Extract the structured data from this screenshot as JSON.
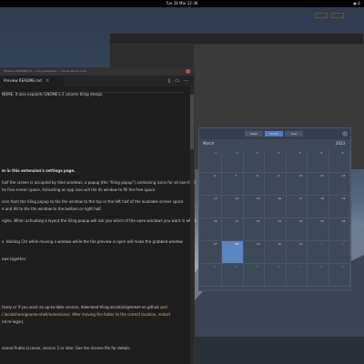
{
  "topbar": {
    "clock": "Tue 28 Mar  22:36",
    "tray": "◉ ⏻"
  },
  "term": {
    "title": "",
    "tab_colors": [
      "#2e8b57",
      "#b23fb2",
      "#c8d23a",
      "#3aa0d2"
    ]
  },
  "vscode": {
    "title": "Preview README.md — tiling-assistant — Visual Studio Code",
    "tab_label": "Preview README.md",
    "tab_close": "X",
    "icons": [
      "split-icon",
      "copy-icon",
      "more-icon"
    ],
    "lines": [
      "NOME. It also expands GNOME's 2 column tiling design.",
      "m in this extension's settings page.",
      "half the screen is occupied by tiled windows, a popup (the \"tiling popup\") containing icons for all non-tiled",
      "he free screen space. Activating an app icon will tile its window to fill the free space.",
      "icon from the tiling popup to tile the window to the top or the left half of the available screen space",
      "e and Alt to tile the window to the bottom or right half.",
      "ngles. When activating a layout the tiling popup will ask you which of the open windows you want in which",
      "s. Holding Ctrl while moving a window while the tile preview is open will make the grabbed window",
      "ows together.",
      "tively or if you want an up-to-date version, download tiling-assistant@leleat-on-github and",
      "/.local/share/gnome-shell/extensions/. After moving the folder to the correct location, restart",
      "nd re-login).",
      "eneral Public License, version 2 or later. See the license file for details."
    ]
  },
  "calendar": {
    "views": [
      "Week",
      "Month",
      "Year"
    ],
    "active_view": "Month",
    "month": "March",
    "year": "2023",
    "days": [
      "27",
      "28",
      "1",
      "2",
      "3",
      "4",
      "5",
      "6",
      "7",
      "8",
      "9",
      "10",
      "11",
      "12",
      "13",
      "14",
      "15",
      "16",
      "17",
      "18",
      "19",
      "20",
      "21",
      "22",
      "23",
      "24",
      "25",
      "26",
      "27",
      "28",
      "29",
      "30",
      "31",
      "1",
      "2",
      "3",
      "4",
      "5",
      "6",
      "7",
      "8",
      "9"
    ],
    "today_index": 29
  }
}
